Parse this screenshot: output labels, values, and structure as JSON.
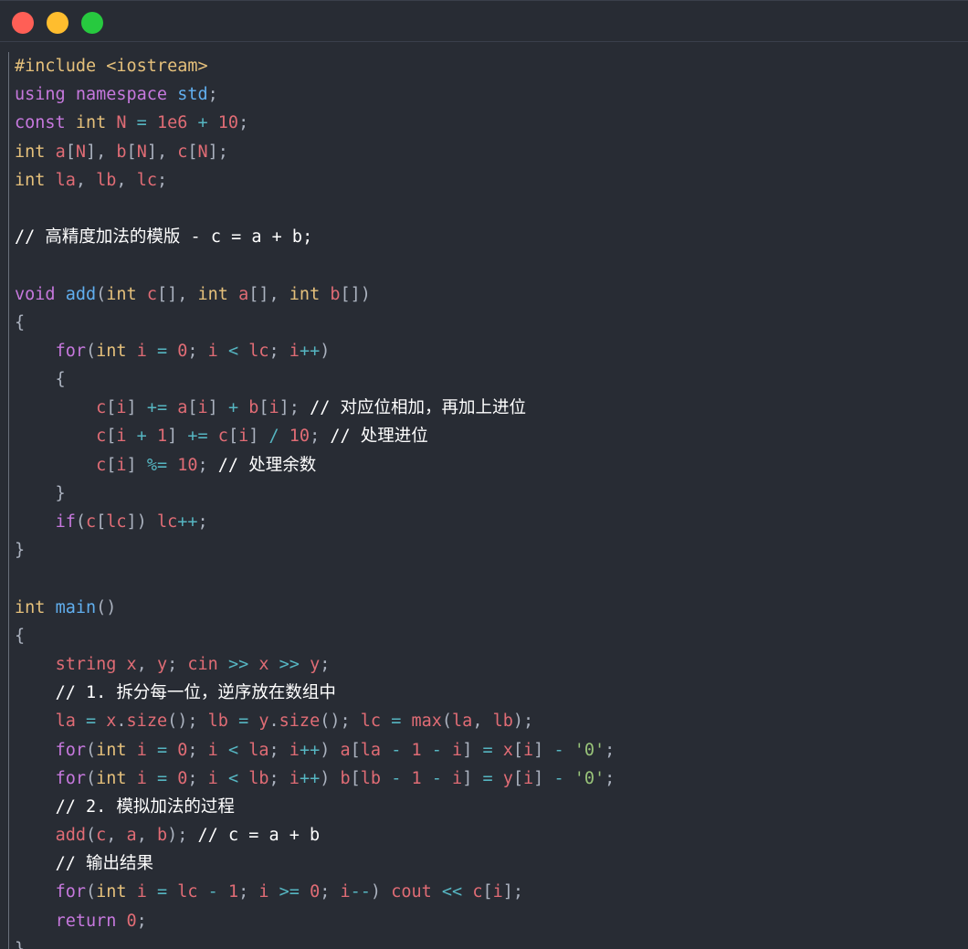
{
  "window": {
    "controls": [
      {
        "name": "close",
        "color": "#ff5f56"
      },
      {
        "name": "minimize",
        "color": "#ffbd2e"
      },
      {
        "name": "zoom",
        "color": "#27c93f"
      }
    ]
  },
  "code": {
    "lines": [
      [
        {
          "t": "#include <iostream>",
          "c": "pp"
        }
      ],
      [
        {
          "t": "using ",
          "c": "kw"
        },
        {
          "t": "namespace ",
          "c": "ns"
        },
        {
          "t": "std",
          "c": "std"
        },
        {
          "t": ";",
          "c": "punct"
        }
      ],
      [
        {
          "t": "const ",
          "c": "kw"
        },
        {
          "t": "int ",
          "c": "type"
        },
        {
          "t": "N ",
          "c": "var"
        },
        {
          "t": "= ",
          "c": "op"
        },
        {
          "t": "1e6 ",
          "c": "num"
        },
        {
          "t": "+ ",
          "c": "op"
        },
        {
          "t": "10",
          "c": "num"
        },
        {
          "t": ";",
          "c": "punct"
        }
      ],
      [
        {
          "t": "int ",
          "c": "type"
        },
        {
          "t": "a",
          "c": "var"
        },
        {
          "t": "[",
          "c": "punct"
        },
        {
          "t": "N",
          "c": "var"
        },
        {
          "t": "], ",
          "c": "punct"
        },
        {
          "t": "b",
          "c": "var"
        },
        {
          "t": "[",
          "c": "punct"
        },
        {
          "t": "N",
          "c": "var"
        },
        {
          "t": "], ",
          "c": "punct"
        },
        {
          "t": "c",
          "c": "var"
        },
        {
          "t": "[",
          "c": "punct"
        },
        {
          "t": "N",
          "c": "var"
        },
        {
          "t": "];",
          "c": "punct"
        }
      ],
      [
        {
          "t": "int ",
          "c": "type"
        },
        {
          "t": "la",
          "c": "var"
        },
        {
          "t": ", ",
          "c": "punct"
        },
        {
          "t": "lb",
          "c": "var"
        },
        {
          "t": ", ",
          "c": "punct"
        },
        {
          "t": "lc",
          "c": "var"
        },
        {
          "t": ";",
          "c": "punct"
        }
      ],
      [],
      [
        {
          "t": "// 高精度加法的模版 - c = a + b;",
          "c": "comment"
        }
      ],
      [],
      [
        {
          "t": "void ",
          "c": "kw"
        },
        {
          "t": "add",
          "c": "fn"
        },
        {
          "t": "(",
          "c": "punct"
        },
        {
          "t": "int ",
          "c": "type"
        },
        {
          "t": "c",
          "c": "var"
        },
        {
          "t": "[], ",
          "c": "punct"
        },
        {
          "t": "int ",
          "c": "type"
        },
        {
          "t": "a",
          "c": "var"
        },
        {
          "t": "[], ",
          "c": "punct"
        },
        {
          "t": "int ",
          "c": "type"
        },
        {
          "t": "b",
          "c": "var"
        },
        {
          "t": "[])",
          "c": "punct"
        }
      ],
      [
        {
          "t": "{",
          "c": "punct"
        }
      ],
      [
        {
          "t": "    ",
          "c": "plain"
        },
        {
          "t": "for",
          "c": "kw"
        },
        {
          "t": "(",
          "c": "punct"
        },
        {
          "t": "int ",
          "c": "type"
        },
        {
          "t": "i ",
          "c": "var"
        },
        {
          "t": "= ",
          "c": "op"
        },
        {
          "t": "0",
          "c": "num"
        },
        {
          "t": "; ",
          "c": "punct"
        },
        {
          "t": "i ",
          "c": "var"
        },
        {
          "t": "< ",
          "c": "op"
        },
        {
          "t": "lc",
          "c": "var"
        },
        {
          "t": "; ",
          "c": "punct"
        },
        {
          "t": "i",
          "c": "var"
        },
        {
          "t": "++",
          "c": "op"
        },
        {
          "t": ")",
          "c": "punct"
        }
      ],
      [
        {
          "t": "    {",
          "c": "punct"
        }
      ],
      [
        {
          "t": "        ",
          "c": "plain"
        },
        {
          "t": "c",
          "c": "var"
        },
        {
          "t": "[",
          "c": "punct"
        },
        {
          "t": "i",
          "c": "var"
        },
        {
          "t": "] ",
          "c": "punct"
        },
        {
          "t": "+= ",
          "c": "op"
        },
        {
          "t": "a",
          "c": "var"
        },
        {
          "t": "[",
          "c": "punct"
        },
        {
          "t": "i",
          "c": "var"
        },
        {
          "t": "] ",
          "c": "punct"
        },
        {
          "t": "+ ",
          "c": "op"
        },
        {
          "t": "b",
          "c": "var"
        },
        {
          "t": "[",
          "c": "punct"
        },
        {
          "t": "i",
          "c": "var"
        },
        {
          "t": "]; ",
          "c": "punct"
        },
        {
          "t": "// 对应位相加，再加上进位",
          "c": "comment"
        }
      ],
      [
        {
          "t": "        ",
          "c": "plain"
        },
        {
          "t": "c",
          "c": "var"
        },
        {
          "t": "[",
          "c": "punct"
        },
        {
          "t": "i ",
          "c": "var"
        },
        {
          "t": "+ ",
          "c": "op"
        },
        {
          "t": "1",
          "c": "num"
        },
        {
          "t": "] ",
          "c": "punct"
        },
        {
          "t": "+= ",
          "c": "op"
        },
        {
          "t": "c",
          "c": "var"
        },
        {
          "t": "[",
          "c": "punct"
        },
        {
          "t": "i",
          "c": "var"
        },
        {
          "t": "] ",
          "c": "punct"
        },
        {
          "t": "/ ",
          "c": "op"
        },
        {
          "t": "10",
          "c": "num"
        },
        {
          "t": "; ",
          "c": "punct"
        },
        {
          "t": "// 处理进位",
          "c": "comment"
        }
      ],
      [
        {
          "t": "        ",
          "c": "plain"
        },
        {
          "t": "c",
          "c": "var"
        },
        {
          "t": "[",
          "c": "punct"
        },
        {
          "t": "i",
          "c": "var"
        },
        {
          "t": "] ",
          "c": "punct"
        },
        {
          "t": "%= ",
          "c": "op"
        },
        {
          "t": "10",
          "c": "num"
        },
        {
          "t": "; ",
          "c": "punct"
        },
        {
          "t": "// 处理余数",
          "c": "comment"
        }
      ],
      [
        {
          "t": "    }",
          "c": "punct"
        }
      ],
      [
        {
          "t": "    ",
          "c": "plain"
        },
        {
          "t": "if",
          "c": "kw"
        },
        {
          "t": "(",
          "c": "punct"
        },
        {
          "t": "c",
          "c": "var"
        },
        {
          "t": "[",
          "c": "punct"
        },
        {
          "t": "lc",
          "c": "var"
        },
        {
          "t": "]) ",
          "c": "punct"
        },
        {
          "t": "lc",
          "c": "var"
        },
        {
          "t": "++",
          "c": "op"
        },
        {
          "t": ";",
          "c": "punct"
        }
      ],
      [
        {
          "t": "}",
          "c": "punct"
        }
      ],
      [],
      [
        {
          "t": "int ",
          "c": "type"
        },
        {
          "t": "main",
          "c": "fn"
        },
        {
          "t": "()",
          "c": "punct"
        }
      ],
      [
        {
          "t": "{",
          "c": "punct"
        }
      ],
      [
        {
          "t": "    ",
          "c": "plain"
        },
        {
          "t": "string ",
          "c": "var"
        },
        {
          "t": "x",
          "c": "var"
        },
        {
          "t": ", ",
          "c": "punct"
        },
        {
          "t": "y",
          "c": "var"
        },
        {
          "t": "; ",
          "c": "punct"
        },
        {
          "t": "cin ",
          "c": "var"
        },
        {
          "t": ">> ",
          "c": "op"
        },
        {
          "t": "x ",
          "c": "var"
        },
        {
          "t": ">> ",
          "c": "op"
        },
        {
          "t": "y",
          "c": "var"
        },
        {
          "t": ";",
          "c": "punct"
        }
      ],
      [
        {
          "t": "    ",
          "c": "plain"
        },
        {
          "t": "// 1. 拆分每一位，逆序放在数组中",
          "c": "comment"
        }
      ],
      [
        {
          "t": "    ",
          "c": "plain"
        },
        {
          "t": "la ",
          "c": "var"
        },
        {
          "t": "= ",
          "c": "op"
        },
        {
          "t": "x",
          "c": "var"
        },
        {
          "t": ".",
          "c": "punct"
        },
        {
          "t": "size",
          "c": "var"
        },
        {
          "t": "(); ",
          "c": "punct"
        },
        {
          "t": "lb ",
          "c": "var"
        },
        {
          "t": "= ",
          "c": "op"
        },
        {
          "t": "y",
          "c": "var"
        },
        {
          "t": ".",
          "c": "punct"
        },
        {
          "t": "size",
          "c": "var"
        },
        {
          "t": "(); ",
          "c": "punct"
        },
        {
          "t": "lc ",
          "c": "var"
        },
        {
          "t": "= ",
          "c": "op"
        },
        {
          "t": "max",
          "c": "var"
        },
        {
          "t": "(",
          "c": "punct"
        },
        {
          "t": "la",
          "c": "var"
        },
        {
          "t": ", ",
          "c": "punct"
        },
        {
          "t": "lb",
          "c": "var"
        },
        {
          "t": ");",
          "c": "punct"
        }
      ],
      [
        {
          "t": "    ",
          "c": "plain"
        },
        {
          "t": "for",
          "c": "kw"
        },
        {
          "t": "(",
          "c": "punct"
        },
        {
          "t": "int ",
          "c": "type"
        },
        {
          "t": "i ",
          "c": "var"
        },
        {
          "t": "= ",
          "c": "op"
        },
        {
          "t": "0",
          "c": "num"
        },
        {
          "t": "; ",
          "c": "punct"
        },
        {
          "t": "i ",
          "c": "var"
        },
        {
          "t": "< ",
          "c": "op"
        },
        {
          "t": "la",
          "c": "var"
        },
        {
          "t": "; ",
          "c": "punct"
        },
        {
          "t": "i",
          "c": "var"
        },
        {
          "t": "++",
          "c": "op"
        },
        {
          "t": ") ",
          "c": "punct"
        },
        {
          "t": "a",
          "c": "var"
        },
        {
          "t": "[",
          "c": "punct"
        },
        {
          "t": "la ",
          "c": "var"
        },
        {
          "t": "- ",
          "c": "op"
        },
        {
          "t": "1 ",
          "c": "num"
        },
        {
          "t": "- ",
          "c": "op"
        },
        {
          "t": "i",
          "c": "var"
        },
        {
          "t": "] ",
          "c": "punct"
        },
        {
          "t": "= ",
          "c": "op"
        },
        {
          "t": "x",
          "c": "var"
        },
        {
          "t": "[",
          "c": "punct"
        },
        {
          "t": "i",
          "c": "var"
        },
        {
          "t": "] ",
          "c": "punct"
        },
        {
          "t": "- ",
          "c": "op"
        },
        {
          "t": "'0'",
          "c": "str"
        },
        {
          "t": ";",
          "c": "punct"
        }
      ],
      [
        {
          "t": "    ",
          "c": "plain"
        },
        {
          "t": "for",
          "c": "kw"
        },
        {
          "t": "(",
          "c": "punct"
        },
        {
          "t": "int ",
          "c": "type"
        },
        {
          "t": "i ",
          "c": "var"
        },
        {
          "t": "= ",
          "c": "op"
        },
        {
          "t": "0",
          "c": "num"
        },
        {
          "t": "; ",
          "c": "punct"
        },
        {
          "t": "i ",
          "c": "var"
        },
        {
          "t": "< ",
          "c": "op"
        },
        {
          "t": "lb",
          "c": "var"
        },
        {
          "t": "; ",
          "c": "punct"
        },
        {
          "t": "i",
          "c": "var"
        },
        {
          "t": "++",
          "c": "op"
        },
        {
          "t": ") ",
          "c": "punct"
        },
        {
          "t": "b",
          "c": "var"
        },
        {
          "t": "[",
          "c": "punct"
        },
        {
          "t": "lb ",
          "c": "var"
        },
        {
          "t": "- ",
          "c": "op"
        },
        {
          "t": "1 ",
          "c": "num"
        },
        {
          "t": "- ",
          "c": "op"
        },
        {
          "t": "i",
          "c": "var"
        },
        {
          "t": "] ",
          "c": "punct"
        },
        {
          "t": "= ",
          "c": "op"
        },
        {
          "t": "y",
          "c": "var"
        },
        {
          "t": "[",
          "c": "punct"
        },
        {
          "t": "i",
          "c": "var"
        },
        {
          "t": "] ",
          "c": "punct"
        },
        {
          "t": "- ",
          "c": "op"
        },
        {
          "t": "'0'",
          "c": "str"
        },
        {
          "t": ";",
          "c": "punct"
        }
      ],
      [
        {
          "t": "    ",
          "c": "plain"
        },
        {
          "t": "// 2. 模拟加法的过程",
          "c": "comment"
        }
      ],
      [
        {
          "t": "    ",
          "c": "plain"
        },
        {
          "t": "add",
          "c": "var"
        },
        {
          "t": "(",
          "c": "punct"
        },
        {
          "t": "c",
          "c": "var"
        },
        {
          "t": ", ",
          "c": "punct"
        },
        {
          "t": "a",
          "c": "var"
        },
        {
          "t": ", ",
          "c": "punct"
        },
        {
          "t": "b",
          "c": "var"
        },
        {
          "t": "); ",
          "c": "punct"
        },
        {
          "t": "// c = a + b",
          "c": "comment"
        }
      ],
      [
        {
          "t": "    ",
          "c": "plain"
        },
        {
          "t": "// 输出结果",
          "c": "comment"
        }
      ],
      [
        {
          "t": "    ",
          "c": "plain"
        },
        {
          "t": "for",
          "c": "kw"
        },
        {
          "t": "(",
          "c": "punct"
        },
        {
          "t": "int ",
          "c": "type"
        },
        {
          "t": "i ",
          "c": "var"
        },
        {
          "t": "= ",
          "c": "op"
        },
        {
          "t": "lc ",
          "c": "var"
        },
        {
          "t": "- ",
          "c": "op"
        },
        {
          "t": "1",
          "c": "num"
        },
        {
          "t": "; ",
          "c": "punct"
        },
        {
          "t": "i ",
          "c": "var"
        },
        {
          "t": ">= ",
          "c": "op"
        },
        {
          "t": "0",
          "c": "num"
        },
        {
          "t": "; ",
          "c": "punct"
        },
        {
          "t": "i",
          "c": "var"
        },
        {
          "t": "--",
          "c": "op"
        },
        {
          "t": ") ",
          "c": "punct"
        },
        {
          "t": "cout ",
          "c": "var"
        },
        {
          "t": "<< ",
          "c": "op"
        },
        {
          "t": "c",
          "c": "var"
        },
        {
          "t": "[",
          "c": "punct"
        },
        {
          "t": "i",
          "c": "var"
        },
        {
          "t": "];",
          "c": "punct"
        }
      ],
      [
        {
          "t": "    ",
          "c": "plain"
        },
        {
          "t": "return ",
          "c": "kw"
        },
        {
          "t": "0",
          "c": "num"
        },
        {
          "t": ";",
          "c": "punct"
        }
      ],
      [
        {
          "t": "}",
          "c": "punct"
        }
      ]
    ]
  }
}
